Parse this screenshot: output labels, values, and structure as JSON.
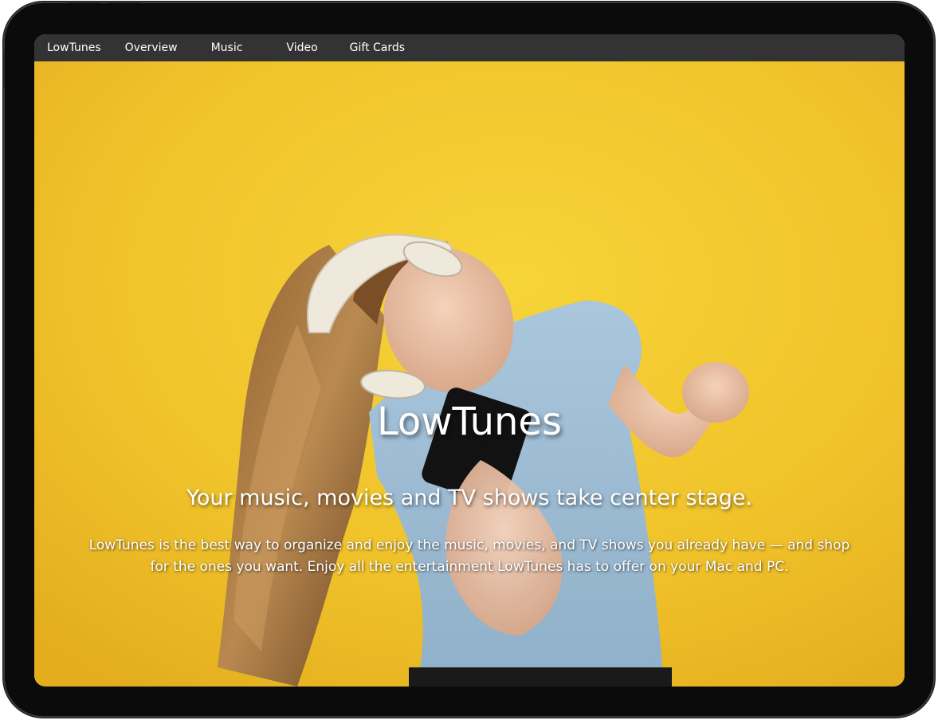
{
  "nav": {
    "brand": "LowTunes",
    "items": [
      {
        "label": "Overview"
      },
      {
        "label": "Music"
      },
      {
        "label": "Video"
      },
      {
        "label": "Gift Cards"
      }
    ]
  },
  "hero": {
    "title": "LowTunes",
    "tagline": "Your music, movies and TV shows take center stage.",
    "description_line1": "LowTunes is the best way to organize and enjoy the music, movies, and TV shows you already have — and shop",
    "description_line2": "for the ones you want. Enjoy all the entertainment LowTunes has to offer on your Mac and PC."
  },
  "colors": {
    "navbar": "#333333",
    "hero_background": "#f2c62e",
    "device_frame": "#0b0b0b",
    "text": "#ffffff"
  }
}
